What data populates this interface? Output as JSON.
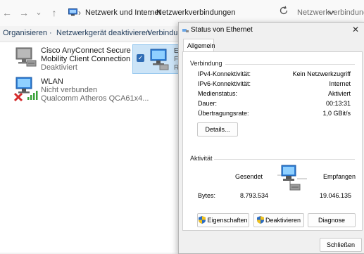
{
  "explorer": {
    "nav": {
      "back": "←",
      "forward": "→",
      "recent": "⌄",
      "up": "↑"
    },
    "breadcrumb": [
      "Netzwerk und Internet",
      "Netzwerkverbindungen"
    ],
    "breadcrumb_separator": "›",
    "search_placeholder": "Netzwerkverbindungen d",
    "commands": [
      "Organisieren ·",
      "Netzwerkgerät deaktivieren",
      "Verbindung"
    ],
    "connections": [
      {
        "name_line1": "Cisco AnyConnect Secure",
        "name_line2": "Mobility Client Connection",
        "status": "Deaktiviert",
        "icon": "vpn-adapter-icon"
      },
      {
        "name_line1": "WLAN",
        "status": "Nicht verbunden",
        "device": "Qualcomm Atheros QCA61x4...",
        "icon": "wifi-adapter-disconnected-icon"
      }
    ],
    "selected_item_fragments": [
      "Et",
      "Fi",
      "R"
    ]
  },
  "dialog": {
    "title": "Status von Ethernet",
    "close": "✕",
    "tab": "Allgemein",
    "connection_section": "Verbindung",
    "fields": [
      {
        "label": "IPv4-Konnektivität:",
        "value": "Kein Netzwerkzugriff"
      },
      {
        "label": "IPv6-Konnektivität:",
        "value": "Internet"
      },
      {
        "label": "Medienstatus:",
        "value": "Aktiviert"
      },
      {
        "label": "Dauer:",
        "value": "00:13:31"
      },
      {
        "label": "Übertragungsrate:",
        "value": "1,0 GBit/s"
      }
    ],
    "details_button": "Details...",
    "activity_section": "Aktivität",
    "sent_label": "Gesendet",
    "received_label": "Empfangen",
    "bytes_label": "Bytes:",
    "bytes_sent": "8.793.534",
    "bytes_received": "19.046.135",
    "buttons": {
      "properties": "Eigenschaften",
      "disable": "Deaktivieren",
      "diagnose": "Diagnose"
    },
    "close_button": "Schließen"
  },
  "colors": {
    "accent": "#2f6cb5",
    "selection": "#cce4f7",
    "shield_blue": "#2b6cc4",
    "shield_yellow": "#f2c21b"
  }
}
